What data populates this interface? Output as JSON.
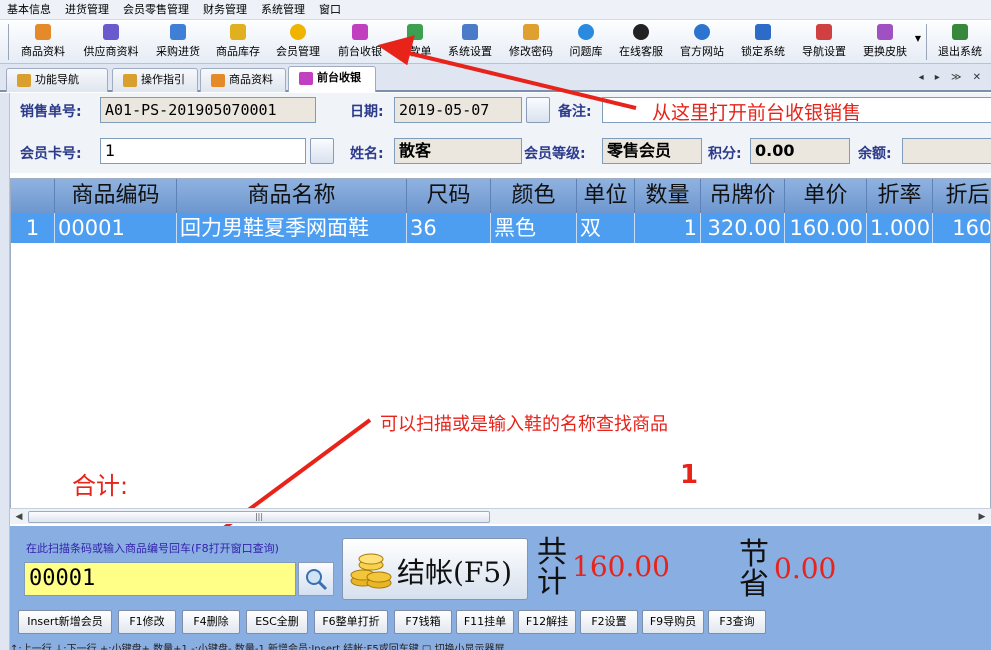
{
  "menu": [
    "基本信息",
    "进货管理",
    "会员零售管理",
    "财务管理",
    "系统管理",
    "窗口"
  ],
  "toolbar": [
    {
      "label": "商品资料",
      "icon": "goods-icon",
      "color": "#e58a28"
    },
    {
      "label": "供应商资料",
      "icon": "supplier-icon",
      "color": "#6a5acd"
    },
    {
      "label": "采购进货",
      "icon": "truck-icon",
      "color": "#3f7fd6"
    },
    {
      "label": "商品库存",
      "icon": "stock-icon",
      "color": "#e0b020"
    },
    {
      "label": "会员管理",
      "icon": "member-icon",
      "color": "#f0b400"
    },
    {
      "label": "前台收银",
      "icon": "cashier-icon",
      "color": "#c040c0"
    },
    {
      "label": "付款单",
      "icon": "payment-icon",
      "color": "#3ca050"
    },
    {
      "label": "系统设置",
      "icon": "settings-icon",
      "color": "#4a7ac8"
    },
    {
      "label": "修改密码",
      "icon": "password-icon",
      "color": "#e0a030"
    },
    {
      "label": "问题库",
      "icon": "question-icon",
      "color": "#2a8ae0"
    },
    {
      "label": "在线客服",
      "icon": "qq-icon",
      "color": "#222222"
    },
    {
      "label": "官方网站",
      "icon": "globe-icon",
      "color": "#2c74d0"
    },
    {
      "label": "锁定系统",
      "icon": "lock-icon",
      "color": "#2c6cc8"
    },
    {
      "label": "导航设置",
      "icon": "nav-icon",
      "color": "#d04040"
    },
    {
      "label": "更换皮肤",
      "icon": "skin-icon",
      "color": "#a050c0"
    },
    {
      "label": "退出系统",
      "icon": "exit-icon",
      "color": "#38883c"
    }
  ],
  "tabs": [
    {
      "label": "功能导航"
    },
    {
      "label": "操作指引"
    },
    {
      "label": "商品资料"
    },
    {
      "label": "前台收银"
    }
  ],
  "tabnav": "◂ ▸ ≫ ✕",
  "form": {
    "order_no_label": "销售单号:",
    "order_no": "A01-PS-201905070001",
    "date_label": "日期:",
    "date": "2019-05-07",
    "note_label": "备注:",
    "note": "",
    "card_label": "会员卡号:",
    "card": "1",
    "name_label": "姓名:",
    "name": "散客",
    "level_label": "会员等级:",
    "level": "零售会员",
    "points_label": "积分:",
    "points": "0.00",
    "balance_label": "余额:",
    "balance": ""
  },
  "grid": {
    "headers": [
      "",
      "商品编码",
      "商品名称",
      "尺码",
      "颜色",
      "单位",
      "数量",
      "吊牌价",
      "单价",
      "折率",
      "折后"
    ],
    "rows": [
      [
        "1",
        "00001",
        "回力男鞋夏季网面鞋",
        "36",
        "黑色",
        "双",
        "1",
        "320.00",
        "160.00",
        "1.000",
        "160."
      ]
    ]
  },
  "annotations": {
    "top": "从这里打开前台收银销售",
    "middle": "可以扫描或是输入鞋的名称查找商品"
  },
  "total": {
    "label": "合计:",
    "count": "1"
  },
  "scrollbar_thumb": "|||",
  "barcode": {
    "hint": "在此扫描条码或输入商品编号回车(F8打开窗口查询)",
    "value": "00001"
  },
  "checkout": {
    "label": "结帐(F5)"
  },
  "summary": {
    "total_label": "共计",
    "total_value": "160.00",
    "saved_label": "节省",
    "saved_value": "0.00"
  },
  "fkeys": [
    "Insert新增会员",
    "F1修改",
    "F4删除",
    "ESC全删",
    "F6整单打折",
    "F7钱箱",
    "F11挂单",
    "F12解挂",
    "F2设置",
    "F9导购员",
    "F3查询"
  ],
  "statusline": "↑:上一行  ↓:下一行  +:小键盘+ 数量+1  -:小键盘- 数量-1  新增会员:Insert  结帐:F5或回车键    □ 切换小显示器屏",
  "colors": {
    "accent": "#4d9ef0",
    "annotation_red": "#e8231a",
    "bottom_panel": "#89aee2"
  }
}
